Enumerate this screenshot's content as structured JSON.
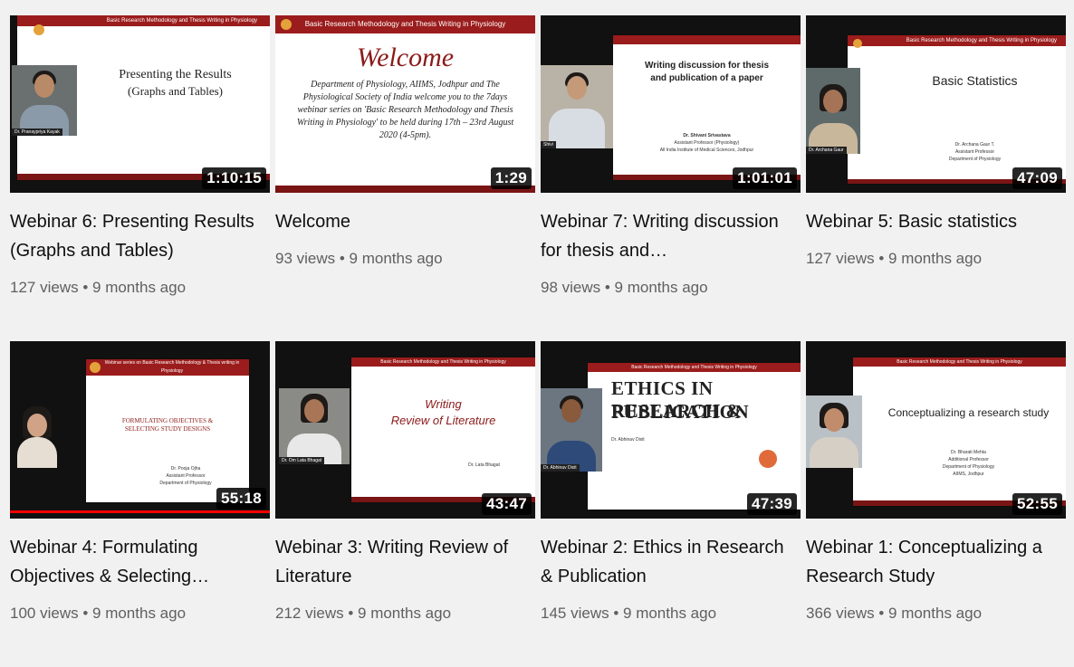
{
  "videos": [
    {
      "title": "Webinar 6: Presenting Results (Graphs and Tables)",
      "views": "127 views",
      "age": "9 months ago",
      "duration": "1:10:15",
      "slide_header": "Basic Research Methodology and Thesis Writing in Physiology",
      "slide_title_1": "Presenting the Results",
      "slide_title_2": "(Graphs and Tables)",
      "cam_label": "Dr. Pranaypriya Kayak"
    },
    {
      "title": "Welcome",
      "views": "93 views",
      "age": "9 months ago",
      "duration": "1:29",
      "slide_header": "Basic Research Methodology and Thesis Writing in Physiology",
      "slide_title_1": "Welcome",
      "slide_body": "Department of Physiology, AIIMS, Jodhpur and The Physiological Society of India welcome you to the 7days webinar series on 'Basic Research Methodology and Thesis Writing in Physiology' to be held during 17th – 23rd August 2020 (4-5pm)."
    },
    {
      "title": "Webinar 7: Writing discussion for thesis and…",
      "views": "98 views",
      "age": "9 months ago",
      "duration": "1:01:01",
      "slide_title_1": "Writing discussion for thesis",
      "slide_title_2": "and publication of a paper",
      "slide_small_1": "Dr. Shivani Srivastava",
      "slide_small_2": "Assistant Professor (Physiology)",
      "slide_small_3": "All India Institute of Medical Sciences, Jodhpur",
      "cam_label": "Shivi"
    },
    {
      "title": "Webinar 5: Basic statistics",
      "views": "127 views",
      "age": "9 months ago",
      "duration": "47:09",
      "slide_header": "Basic Research Methodology and Thesis Writing in Physiology",
      "slide_title_1": "Basic Statistics",
      "slide_small_1": "Dr. Archana Gaur T.",
      "slide_small_2": "Assistant Professor",
      "slide_small_3": "Department of Physiology",
      "cam_label": "Dr. Archana Gaur"
    },
    {
      "title": "Webinar 4: Formulating Objectives & Selecting…",
      "views": "100 views",
      "age": "9 months ago",
      "duration": "55:18",
      "slide_header": "Webinar series on Basic Research Methodology & Thesis writing in Physiology",
      "slide_title_1": "FORMULATING OBJECTIVES &",
      "slide_title_2": "SELECTING STUDY DESIGNS",
      "slide_small_1": "Dr. Pooja Ojha",
      "slide_small_2": "Assistant Professor",
      "slide_small_3": "Department of Physiology"
    },
    {
      "title": "Webinar 3: Writing Review of Literature",
      "views": "212 views",
      "age": "9 months ago",
      "duration": "43:47",
      "slide_header": "Basic Research Methodology and Thesis Writing in Physiology",
      "slide_title_1": "Writing",
      "slide_title_2": "Review of Literature",
      "slide_small_1": "Dr. Lata Bhagat",
      "cam_label": "Dr. Om Lata Bhagat"
    },
    {
      "title": "Webinar 2: Ethics in Research & Publication",
      "views": "145 views",
      "age": "9 months ago",
      "duration": "47:39",
      "slide_header": "Basic Research Methodology and Thesis Writing in Physiology",
      "slide_title_1": "ETHICS IN RESEARCH &",
      "slide_title_2": "PUBLICATION",
      "slide_small_1": "Dr. Abhinav Dixit",
      "cam_label": "Dr. Abhinav Dixit"
    },
    {
      "title": "Webinar 1: Conceptualizing a Research Study",
      "views": "366 views",
      "age": "9 months ago",
      "duration": "52:55",
      "slide_header": "Basic Research Methodology and Thesis Writing in Physiology",
      "slide_title_1": "Conceptualizing a research study",
      "slide_small_1": "Dr. Bharati Mehta",
      "slide_small_2": "Additional Professor",
      "slide_small_3": "Department of Physiology",
      "slide_small_4": "AIIMS, Jodhpur"
    }
  ],
  "colors": {
    "background": "#f1f1f1",
    "title_text": "#0f0f0f",
    "meta_text": "#606060",
    "slide_header": "#9b1c1c",
    "progress": "#ff0000"
  }
}
